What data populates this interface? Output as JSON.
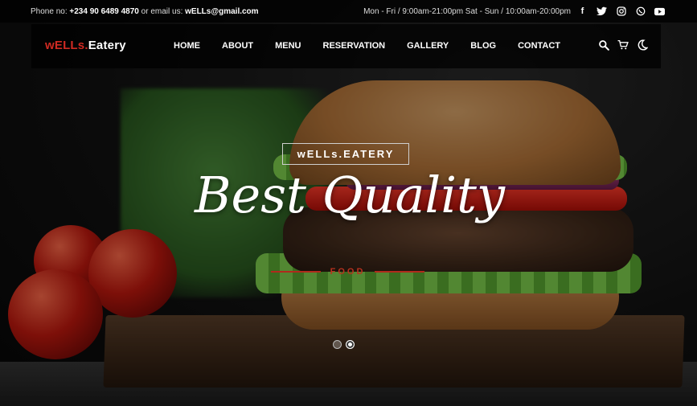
{
  "topbar": {
    "phone_label": "Phone no:",
    "phone": "+234 90 6489 4870",
    "email_label": "or email us:",
    "email": "wELLs@gmail.com",
    "hours": "Mon - Fri / 9:00am-21:00pm Sat - Sun / 10:00am-20:00pm",
    "social": [
      {
        "name": "facebook-icon",
        "glyph": "f"
      },
      {
        "name": "twitter-icon",
        "glyph": "t"
      },
      {
        "name": "instagram-icon",
        "glyph": "◎"
      },
      {
        "name": "whatsapp-icon",
        "glyph": "✆"
      },
      {
        "name": "youtube-icon",
        "glyph": "▶"
      }
    ]
  },
  "nav": {
    "logo_red": "wELLs.",
    "logo_white": "Eatery",
    "items": [
      "HOME",
      "ABOUT",
      "MENU",
      "RESERVATION",
      "GALLERY",
      "BLOG",
      "CONTACT"
    ],
    "icons": [
      "search-icon",
      "cart-icon",
      "moon-icon"
    ]
  },
  "hero": {
    "badge": "wELLs.EATERY",
    "headline": "Best Quality",
    "subtitle": "FOOD",
    "slides": 2,
    "active_slide": 2
  },
  "colors": {
    "accent": "#d02a22",
    "subtitle": "#b8321f"
  }
}
